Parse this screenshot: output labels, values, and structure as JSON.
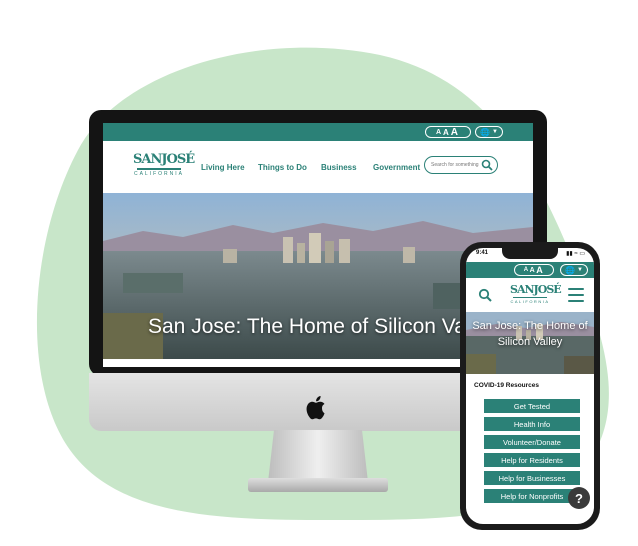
{
  "colors": {
    "brand_teal": "#2b8177",
    "blob_green": "#c8e6c9"
  },
  "desktop": {
    "font_size_controls": [
      "A",
      "A",
      "A"
    ],
    "language_icon": "globe-icon",
    "logo": {
      "main": "SANJOSÉ",
      "sub": "CALIFORNIA"
    },
    "nav": [
      "Living Here",
      "Things to Do",
      "Business",
      "Government"
    ],
    "search": {
      "placeholder": "Search for something"
    },
    "hero_title": "San Jose: The Home of Silicon Val"
  },
  "mobile": {
    "status": {
      "time": "9:41",
      "icons": "▮▮ ≈ ▭"
    },
    "font_size_controls": [
      "A",
      "A",
      "A"
    ],
    "language_icon": "globe-icon",
    "logo": {
      "main": "SANJOSÉ",
      "sub": "CALIFORNIA"
    },
    "hero_title": "San Jose: The Home of Silicon Valley",
    "section_title": "COVID-19 Resources",
    "buttons": [
      "Get Tested",
      "Health Info",
      "Volunteer/Donate",
      "Help for Residents",
      "Help for Businesses",
      "Help for Nonprofits"
    ],
    "help": "?"
  }
}
